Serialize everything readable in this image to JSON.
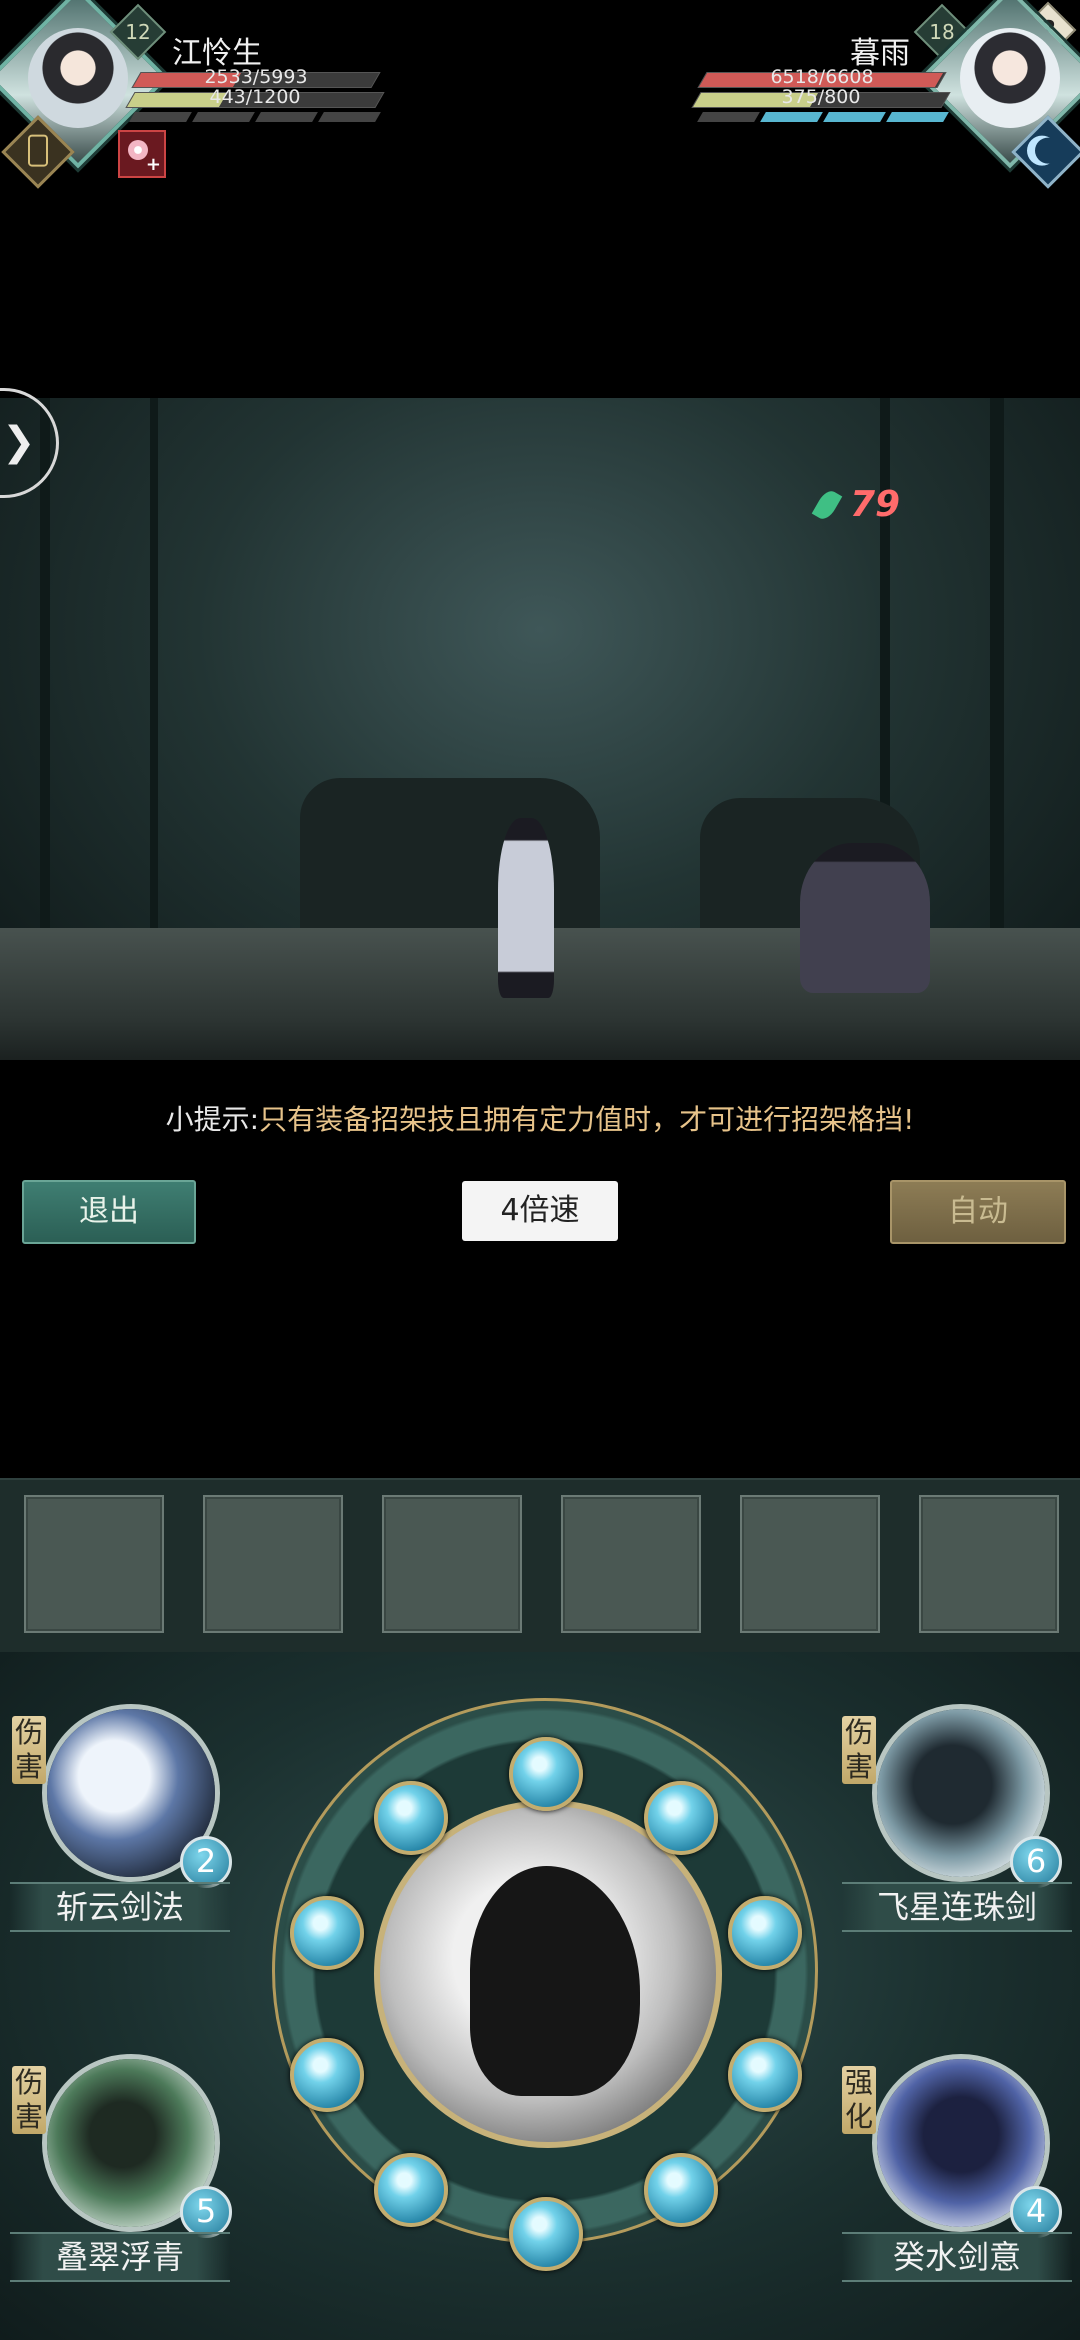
{
  "player": {
    "name": "江怜生",
    "level": "12",
    "hp_text": "2533/5993",
    "hp_fraction": 0.42,
    "mp_text": "443/1200",
    "mp_fraction": 0.37,
    "stance_segments_filled": 0,
    "stance_segments_total": 4,
    "buff_icon": "flower-plus-icon",
    "emblem_icon": "crest-icon"
  },
  "enemy": {
    "name": "暮雨",
    "level": "18",
    "hp_text": "6518/6608",
    "hp_fraction": 0.99,
    "mp_text": "375/800",
    "mp_fraction": 0.47,
    "stance_segments_filled": 3,
    "stance_segments_total": 4,
    "help_label": "?",
    "moon_icon": "crescent-moon-icon"
  },
  "battle": {
    "damage_number": "79",
    "side_toggle_icon": "chevron-right-icon"
  },
  "tip": {
    "label": "小提示:",
    "text": "只有装备招架技且拥有定力值时，才可进行招架格挡!"
  },
  "controls": {
    "exit_label": "退出",
    "speed_label": "4倍速",
    "auto_label": "自动"
  },
  "slots": {
    "count": 6
  },
  "skills": [
    {
      "name": "斩云剑法",
      "tag": "伤害",
      "count": "2"
    },
    {
      "name": "飞星连珠剑",
      "tag": "伤害",
      "count": "6"
    },
    {
      "name": "叠翠浮青",
      "tag": "伤害",
      "count": "5"
    },
    {
      "name": "癸水剑意",
      "tag": "强化",
      "count": "4"
    }
  ],
  "wheel": {
    "orb_count": 10
  },
  "colors": {
    "hp": "#d05a57",
    "mp": "#c9cf8a",
    "energy": "#58b6d0",
    "tip_text": "#e7c38a"
  }
}
